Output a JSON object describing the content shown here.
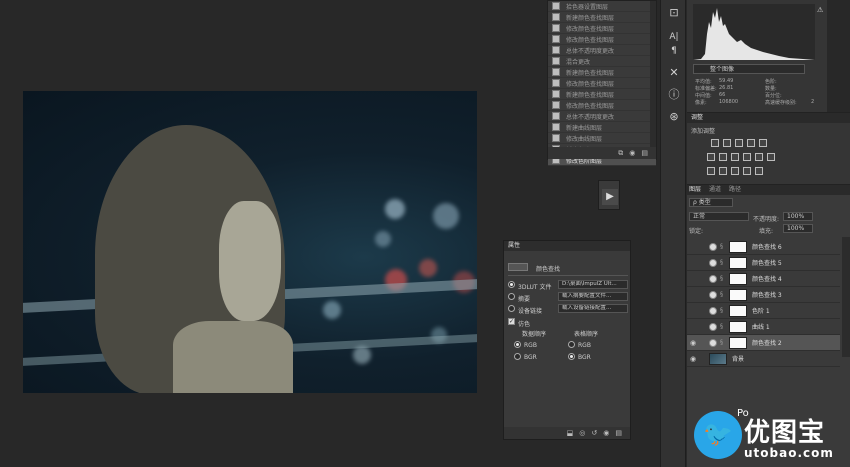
{
  "history": {
    "items": [
      {
        "label": "拾色器设置图层"
      },
      {
        "label": "新建颜色查找图层"
      },
      {
        "label": "修改颜色查找图层"
      },
      {
        "label": "修改颜色查找图层"
      },
      {
        "label": "总体不透明度更改"
      },
      {
        "label": "混合更改"
      },
      {
        "label": "新建颜色查找图层"
      },
      {
        "label": "修改颜色查找图层"
      },
      {
        "label": "新建颜色查找图层"
      },
      {
        "label": "修改颜色查找图层"
      },
      {
        "label": "总体不透明度更改"
      },
      {
        "label": "新建曲线图层"
      },
      {
        "label": "修改曲线图层"
      },
      {
        "label": "新建色阶图层"
      },
      {
        "label": "修改色阶图层"
      }
    ],
    "selected_index": 14
  },
  "histogram": {
    "channel_select": "整个图像",
    "stats": {
      "mean_label": "平均值:",
      "mean": "59.49",
      "stddev_label": "标准偏差:",
      "stddev": "26.81",
      "median_label": "中间值:",
      "median": "66",
      "pixels_label": "像素:",
      "pixels": "106800",
      "level_label": "色阶:",
      "count_label": "数量:",
      "percentile_label": "百分位:",
      "cache_label": "高速缓存级别:",
      "cache": "2"
    }
  },
  "adjustments": {
    "tab": "调整",
    "add_label": "添加调整"
  },
  "layers": {
    "tabs": [
      "图层",
      "通道",
      "路径"
    ],
    "filter_label": "ρ 类型",
    "blend_mode": "正常",
    "opacity_label": "不透明度:",
    "opacity": "100%",
    "lock_label": "锁定:",
    "fill_label": "填充:",
    "fill": "100%",
    "items": [
      {
        "name": "颜色查找 6",
        "type": "adjust",
        "visible": false
      },
      {
        "name": "颜色查找 5",
        "type": "adjust",
        "visible": false
      },
      {
        "name": "颜色查找 4",
        "type": "adjust",
        "visible": false
      },
      {
        "name": "颜色查找 3",
        "type": "adjust",
        "visible": false
      },
      {
        "name": "色阶 1",
        "type": "adjust",
        "visible": false
      },
      {
        "name": "曲线 1",
        "type": "adjust",
        "visible": false
      },
      {
        "name": "颜色查找 2",
        "type": "adjust",
        "visible": true
      },
      {
        "name": "背景",
        "type": "image",
        "visible": true
      }
    ],
    "selected_index": 6
  },
  "properties": {
    "title": "属性",
    "subtitle": "颜色查找",
    "opt1_label": "3DLUT 文件",
    "opt1_value": "D:\\桌面\\ImpulZ Ult...",
    "opt2_label": "摘要",
    "opt2_value": "载入摘要配置文件...",
    "opt3_label": "设备链接",
    "opt3_value": "载入设备链接配置...",
    "dither_label": "仿色",
    "data_order_label": "数据顺序",
    "table_order_label": "表格顺序",
    "rgb": "RGB",
    "bgr": "BGR"
  },
  "watermark": {
    "cn": "优图宝",
    "url": "utobao.com",
    "po": "Po"
  }
}
